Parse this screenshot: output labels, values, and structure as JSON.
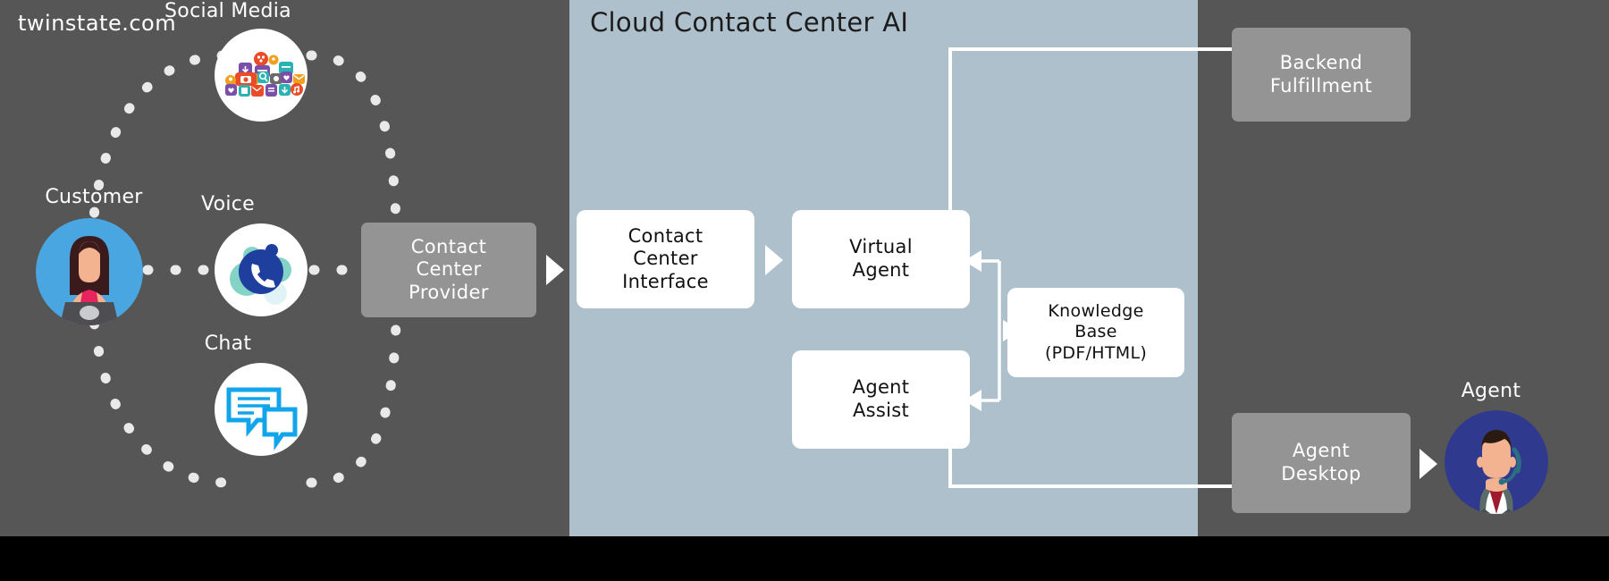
{
  "panel": {
    "title": "Cloud Contact Center AI",
    "bg_color": "#adc0cb"
  },
  "background_color": "#565656",
  "footer": {
    "text": "twinstate.com",
    "bg_color": "#000000"
  },
  "channels": {
    "customer_label": "Customer",
    "social_label": "Social Media",
    "voice_label": "Voice",
    "chat_label": "Chat"
  },
  "boxes": {
    "contact_center_provider": "Contact\nCenter\nProvider",
    "contact_center_provider_lines": [
      "Contact",
      "Center",
      "Provider"
    ],
    "contact_center_interface_lines": [
      "Contact",
      "Center",
      "Interface"
    ],
    "virtual_agent_lines": [
      "Virtual",
      "Agent"
    ],
    "agent_assist_lines": [
      "Agent",
      "Assist"
    ],
    "knowledge_base_lines": [
      "Knowledge",
      "Base",
      "(PDF/HTML)"
    ],
    "backend_fulfillment_lines": [
      "Backend",
      "Fulfillment"
    ],
    "agent_desktop_lines": [
      "Agent",
      "Desktop"
    ]
  },
  "agent": {
    "label": "Agent"
  },
  "colors": {
    "box_gray": "#949494",
    "box_white": "#ffffff",
    "panel_blue_gray": "#adc0cb",
    "customer_circle": "#4aa6e0",
    "agent_circle": "#2f3a8f",
    "voice_blue": "#1f3f9e",
    "chat_blue": "#12a5ec"
  }
}
